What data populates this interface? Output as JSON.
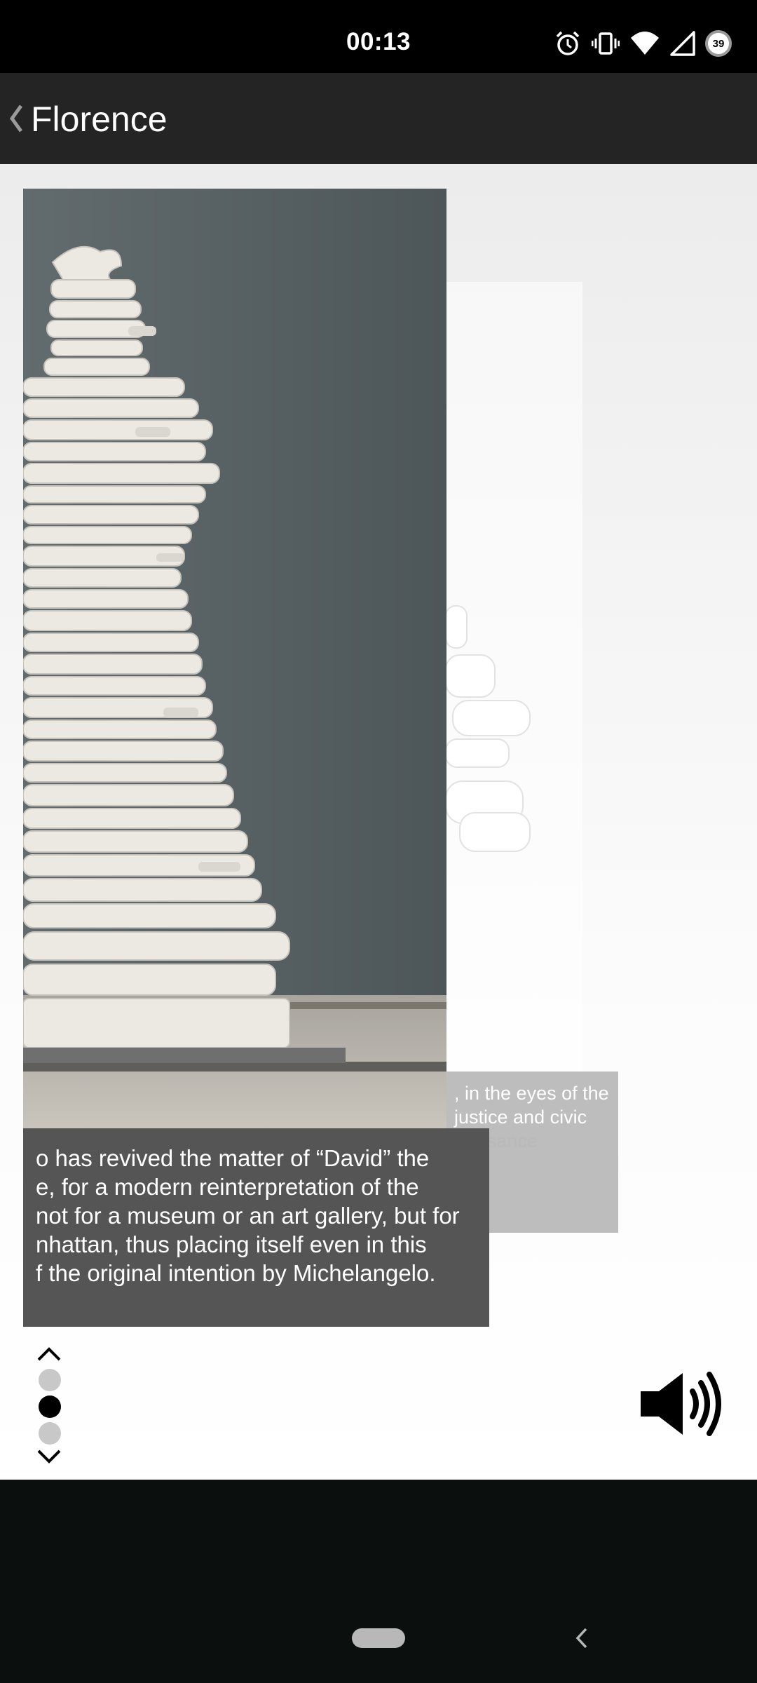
{
  "status_bar": {
    "time": "00:13",
    "battery_level": "39",
    "icons": [
      "alarm-icon",
      "vibrate-icon",
      "wifi-icon",
      "signal-icon",
      "battery-icon"
    ]
  },
  "app_bar": {
    "title": "Florence",
    "back_icon": "chevron-left-icon"
  },
  "background_card": {
    "caption_lines": [
      ", in the eyes of the",
      "justice and civic"
    ]
  },
  "faded_caption": {
    "lines": [
      "pride realised by Florentines at the height of the Renaissance",
      "by Michelangelo ..."
    ]
  },
  "caption": {
    "lines": [
      "o has revived the matter of “David” the",
      "e, for a modern reinterpretation of the",
      "not for a museum or an art gallery, but for",
      "nhattan, thus placing itself even in this",
      "f the original intention by Michelangelo."
    ]
  },
  "pager": {
    "page_count": 3,
    "active_page": 2,
    "up_icon": "chevron-up-icon",
    "down_icon": "chevron-down-icon"
  },
  "audio": {
    "icon": "speaker-icon"
  },
  "colors": {
    "app_bar": "#242424",
    "caption_bg": "#555555",
    "dot_active": "#000000",
    "dot_inactive": "#c8c8c8"
  }
}
